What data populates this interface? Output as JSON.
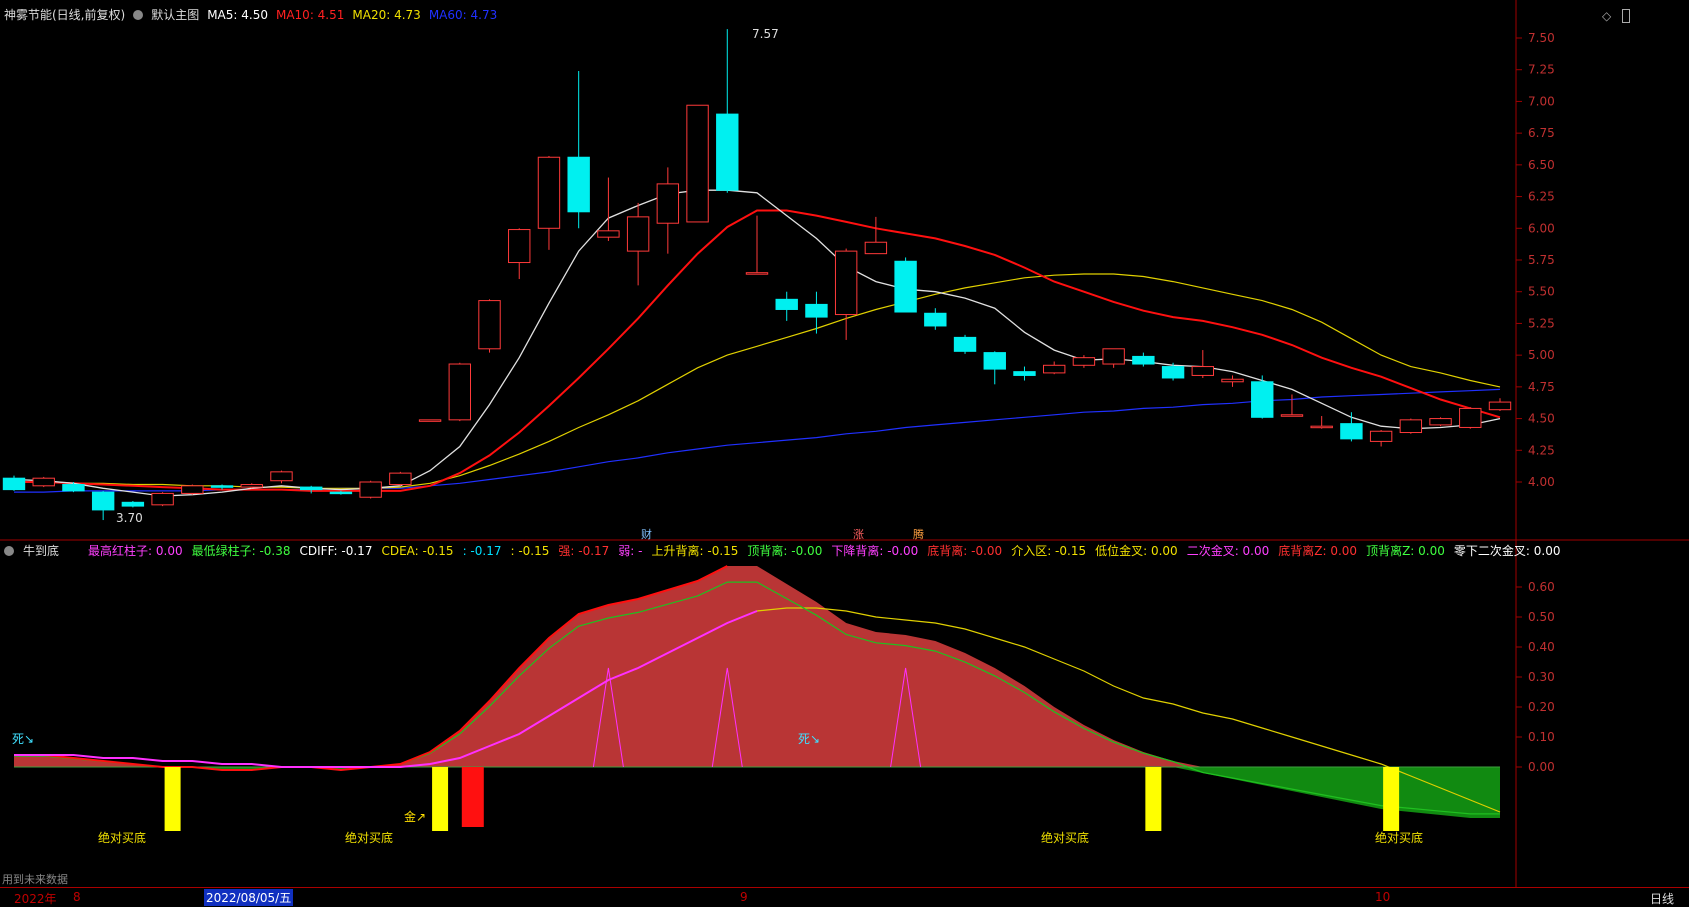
{
  "header": {
    "stock": "神雾节能(日线,前复权)",
    "main_chart": "默认主图",
    "ma": [
      {
        "label": "MA5: 4.50",
        "color": "#ffffff"
      },
      {
        "label": "MA10: 4.51",
        "color": "#ff2020"
      },
      {
        "label": "MA20: 4.73",
        "color": "#f0e000"
      },
      {
        "label": "MA60: 4.73",
        "color": "#2030ff"
      }
    ]
  },
  "indicator": {
    "name": "牛到底",
    "items": [
      {
        "label": "最高红柱子: 0.00",
        "color": "#ff40ff"
      },
      {
        "label": "最低绿柱子: -0.38",
        "color": "#40ff40"
      },
      {
        "label": "CDIFF: -0.17",
        "color": "#ffffff"
      },
      {
        "label": "CDEA: -0.15",
        "color": "#f0e000"
      },
      {
        "label": ": -0.17",
        "color": "#00e0ff"
      },
      {
        "label": ": -0.15",
        "color": "#f0e000"
      },
      {
        "label": "强: -0.17",
        "color": "#ff3030"
      },
      {
        "label": "弱: -",
        "color": "#ff40ff"
      },
      {
        "label": "上升背离: -0.15",
        "color": "#f0e000"
      },
      {
        "label": "顶背离: -0.00",
        "color": "#40ff40"
      },
      {
        "label": "下降背离: -0.00",
        "color": "#ff40ff"
      },
      {
        "label": "底背离: -0.00",
        "color": "#ff3030"
      },
      {
        "label": "介入区: -0.15",
        "color": "#f0e000"
      },
      {
        "label": "低位金叉: 0.00",
        "color": "#f0e000"
      },
      {
        "label": "二次金叉: 0.00",
        "color": "#ff40ff"
      },
      {
        "label": "底背离Z: 0.00",
        "color": "#ff3030"
      },
      {
        "label": "顶背离Z: 0.00",
        "color": "#40ff40"
      },
      {
        "label": "零下二次金叉: 0.00",
        "color": "#ffffff"
      }
    ]
  },
  "price_axis": [
    "7.50",
    "7.25",
    "7.00",
    "6.75",
    "6.50",
    "6.25",
    "6.00",
    "5.75",
    "5.50",
    "5.25",
    "5.00",
    "4.75",
    "4.50",
    "4.25",
    "4.00"
  ],
  "ind_axis": [
    "0.60",
    "0.50",
    "0.40",
    "0.30",
    "0.20",
    "0.10",
    "0.00"
  ],
  "annotations": {
    "high": "7.57",
    "low": "3.70",
    "cai": "财",
    "zhang": "涨",
    "teng": "腾",
    "dead1": "死↘",
    "dead2": "死↘",
    "gold": "金↗",
    "bottom_label": "绝对买底"
  },
  "footer": {
    "year": "2022年",
    "m8": "8",
    "date": "2022/08/05/五",
    "m9": "9",
    "m10": "10",
    "period": "日线",
    "future_note": "用到未来数据"
  },
  "chart_data": {
    "type": "candlestick",
    "candles": [
      [
        4.03,
        3.94,
        4.05,
        3.93
      ],
      [
        3.97,
        4.03,
        4.04,
        3.96
      ],
      [
        3.98,
        3.93,
        4.0,
        3.92
      ],
      [
        3.92,
        3.78,
        3.93,
        3.7
      ],
      [
        3.84,
        3.81,
        3.85,
        3.8
      ],
      [
        3.82,
        3.91,
        3.92,
        3.81
      ],
      [
        3.91,
        3.97,
        3.98,
        3.9
      ],
      [
        3.97,
        3.96,
        3.98,
        3.94
      ],
      [
        3.96,
        3.98,
        3.99,
        3.95
      ],
      [
        4.01,
        4.08,
        4.09,
        3.99
      ],
      [
        3.96,
        3.94,
        3.97,
        3.91
      ],
      [
        3.92,
        3.91,
        3.93,
        3.9
      ],
      [
        3.88,
        4.0,
        4.01,
        3.87
      ],
      [
        3.98,
        4.07,
        4.08,
        3.97
      ],
      [
        4.49,
        4.49,
        4.49,
        4.49
      ],
      [
        4.49,
        4.93,
        4.94,
        4.48
      ],
      [
        5.05,
        5.43,
        5.44,
        5.02
      ],
      [
        5.73,
        5.99,
        6.0,
        5.6
      ],
      [
        6.0,
        6.56,
        6.57,
        5.83
      ],
      [
        6.56,
        6.13,
        7.24,
        6.0
      ],
      [
        5.93,
        5.98,
        6.4,
        5.9
      ],
      [
        5.82,
        6.09,
        6.2,
        5.55
      ],
      [
        6.04,
        6.35,
        6.48,
        5.8
      ],
      [
        6.05,
        6.97,
        6.97,
        6.05
      ],
      [
        6.9,
        6.3,
        7.57,
        6.28
      ],
      [
        5.65,
        5.65,
        6.1,
        5.65
      ],
      [
        5.44,
        5.36,
        5.5,
        5.27
      ],
      [
        5.4,
        5.3,
        5.5,
        5.17
      ],
      [
        5.32,
        5.82,
        5.84,
        5.12
      ],
      [
        5.8,
        5.89,
        6.09,
        5.8
      ],
      [
        5.74,
        5.34,
        5.77,
        5.34
      ],
      [
        5.33,
        5.23,
        5.37,
        5.2
      ],
      [
        5.14,
        5.03,
        5.16,
        5.01
      ],
      [
        5.02,
        4.89,
        5.03,
        4.77
      ],
      [
        4.87,
        4.84,
        4.91,
        4.8
      ],
      [
        4.86,
        4.92,
        4.95,
        4.85
      ],
      [
        4.92,
        4.98,
        5.0,
        4.9
      ],
      [
        4.93,
        5.05,
        5.05,
        4.9
      ],
      [
        4.99,
        4.93,
        5.02,
        4.91
      ],
      [
        4.91,
        4.82,
        4.94,
        4.8
      ],
      [
        4.84,
        4.91,
        5.04,
        4.82
      ],
      [
        4.79,
        4.81,
        4.84,
        4.75
      ],
      [
        4.79,
        4.51,
        4.84,
        4.5
      ],
      [
        4.53,
        4.53,
        4.69,
        4.53
      ],
      [
        4.44,
        4.44,
        4.52,
        4.42
      ],
      [
        4.46,
        4.34,
        4.55,
        4.32
      ],
      [
        4.32,
        4.4,
        4.41,
        4.28
      ],
      [
        4.39,
        4.49,
        4.5,
        4.38
      ],
      [
        4.45,
        4.5,
        4.51,
        4.44
      ],
      [
        4.43,
        4.58,
        4.59,
        4.42
      ],
      [
        4.57,
        4.63,
        4.66,
        4.56
      ]
    ],
    "ma5": [
      4.02,
      4.01,
      3.99,
      3.95,
      3.92,
      3.89,
      3.9,
      3.92,
      3.95,
      3.97,
      3.95,
      3.94,
      3.95,
      3.97,
      4.09,
      4.28,
      4.61,
      4.98,
      5.41,
      5.82,
      6.08,
      6.18,
      6.27,
      6.3,
      6.3,
      6.28,
      6.1,
      5.92,
      5.7,
      5.58,
      5.52,
      5.5,
      5.45,
      5.37,
      5.18,
      5.04,
      4.96,
      4.97,
      4.95,
      4.92,
      4.91,
      4.87,
      4.8,
      4.73,
      4.62,
      4.51,
      4.44,
      4.42,
      4.43,
      4.45,
      4.5
    ],
    "ma10": [
      4.0,
      4.0,
      3.99,
      3.98,
      3.97,
      3.96,
      3.95,
      3.94,
      3.94,
      3.94,
      3.93,
      3.93,
      3.93,
      3.93,
      3.97,
      4.07,
      4.21,
      4.39,
      4.6,
      4.82,
      5.05,
      5.29,
      5.55,
      5.8,
      6.01,
      6.14,
      6.14,
      6.1,
      6.05,
      6.0,
      5.96,
      5.92,
      5.86,
      5.79,
      5.69,
      5.58,
      5.5,
      5.42,
      5.35,
      5.3,
      5.27,
      5.22,
      5.16,
      5.08,
      4.98,
      4.9,
      4.83,
      4.74,
      4.65,
      4.58,
      4.51
    ],
    "ma20": [
      4.0,
      4.0,
      3.99,
      3.99,
      3.98,
      3.98,
      3.97,
      3.97,
      3.96,
      3.96,
      3.95,
      3.95,
      3.95,
      3.96,
      3.99,
      4.05,
      4.13,
      4.22,
      4.32,
      4.43,
      4.53,
      4.64,
      4.77,
      4.9,
      5.0,
      5.07,
      5.14,
      5.21,
      5.29,
      5.36,
      5.42,
      5.48,
      5.53,
      5.57,
      5.61,
      5.63,
      5.64,
      5.64,
      5.62,
      5.58,
      5.53,
      5.48,
      5.43,
      5.36,
      5.26,
      5.13,
      5.0,
      4.91,
      4.86,
      4.8,
      4.75
    ],
    "ma60": [
      3.92,
      3.92,
      3.93,
      3.93,
      3.93,
      3.93,
      3.93,
      3.94,
      3.94,
      3.94,
      3.94,
      3.95,
      3.95,
      3.95,
      3.97,
      3.99,
      4.02,
      4.05,
      4.08,
      4.12,
      4.16,
      4.19,
      4.23,
      4.26,
      4.29,
      4.31,
      4.33,
      4.35,
      4.38,
      4.4,
      4.43,
      4.45,
      4.47,
      4.49,
      4.51,
      4.53,
      4.55,
      4.56,
      4.58,
      4.59,
      4.61,
      4.62,
      4.64,
      4.65,
      4.67,
      4.68,
      4.69,
      4.7,
      4.71,
      4.72,
      4.73
    ],
    "cdiff": [
      0.04,
      0.04,
      0.03,
      0.02,
      0.01,
      0.0,
      0.0,
      -0.01,
      -0.01,
      0.0,
      0.0,
      -0.01,
      0.0,
      0.01,
      0.05,
      0.12,
      0.22,
      0.33,
      0.43,
      0.51,
      0.54,
      0.56,
      0.59,
      0.62,
      0.67,
      0.67,
      0.61,
      0.55,
      0.48,
      0.45,
      0.44,
      0.42,
      0.38,
      0.33,
      0.27,
      0.2,
      0.14,
      0.09,
      0.05,
      0.02,
      -0.02,
      -0.04,
      -0.06,
      -0.08,
      -0.1,
      -0.12,
      -0.14,
      -0.15,
      -0.16,
      -0.17,
      -0.17
    ],
    "cdea": [
      0.04,
      0.04,
      0.04,
      0.03,
      0.03,
      0.02,
      0.02,
      0.01,
      0.01,
      0.0,
      0.0,
      0.0,
      0.0,
      0.0,
      0.01,
      0.03,
      0.07,
      0.11,
      0.17,
      0.23,
      0.29,
      0.33,
      0.38,
      0.43,
      0.48,
      0.52,
      0.53,
      0.53,
      0.52,
      0.5,
      0.49,
      0.48,
      0.46,
      0.43,
      0.4,
      0.36,
      0.32,
      0.27,
      0.23,
      0.21,
      0.18,
      0.16,
      0.13,
      0.1,
      0.07,
      0.04,
      0.01,
      -0.03,
      -0.07,
      -0.11,
      -0.15
    ]
  }
}
